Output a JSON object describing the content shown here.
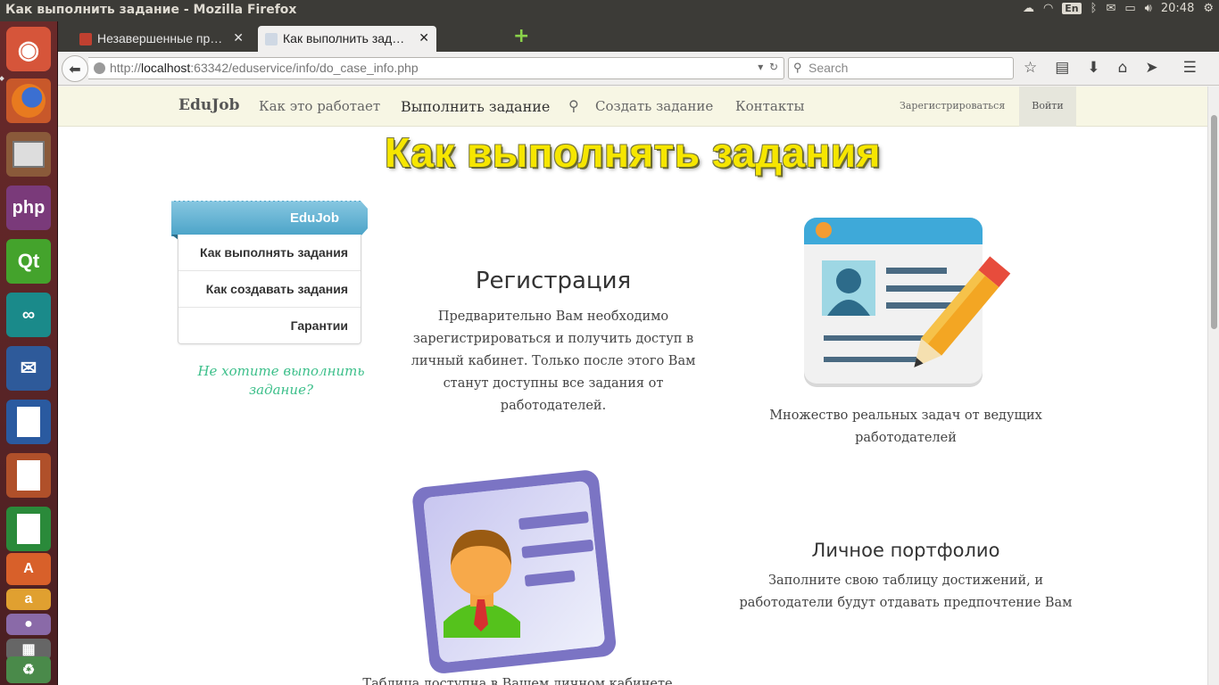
{
  "os": {
    "window_title": "Как выполнить задание - Mozilla Firefox",
    "keyboard_layout": "En",
    "clock": "20:48",
    "launcher_icons": [
      "ubuntu-dash",
      "firefox",
      "files",
      "phpstorm",
      "qt-creator",
      "arduino",
      "thunderbird",
      "libreoffice-writer",
      "libreoffice-impress",
      "libreoffice-calc",
      "ubuntu-software-center",
      "amazon",
      "trash"
    ]
  },
  "browser": {
    "tabs": [
      {
        "label": "Незавершенные пр…",
        "active": false
      },
      {
        "label": "Как выполнить зад…",
        "active": true
      }
    ],
    "url_prefix": "http://",
    "url_host": "localhost",
    "url_rest": ":63342/eduservice/info/do_case_info.php",
    "search_placeholder": "Search"
  },
  "site": {
    "brand": "EduJob",
    "nav": {
      "how_it_works": "Как это работает",
      "do_task": "Выполнить задание",
      "create_task": "Создать задание",
      "contacts": "Контакты",
      "register": "Зарегистрироваться",
      "login": "Войти"
    },
    "heading": "Как выполнять задания",
    "side_menu": {
      "ribbon": "EduJob",
      "items": [
        "Как выполнять задания",
        "Как создавать задания",
        "Гарантии"
      ],
      "link": "Не хотите выполнить задание?"
    },
    "blocks": {
      "registration": {
        "title": "Регистрация",
        "text": "Предварительно Вам необходимо зарегистрироваться и получить доступ в личный кабинет. Только после этого Вам станут доступны все задания от работодателей."
      },
      "tasks_caption": "Множество реальных задач от ведущих работодателей",
      "portfolio": {
        "title": "Личное портфолио",
        "text": "Заполните свою таблицу достижений, и работодатели будут отдавать предпочтение Вам"
      },
      "table_caption": "Таблица доступна в Вашем личном кабинете"
    }
  }
}
